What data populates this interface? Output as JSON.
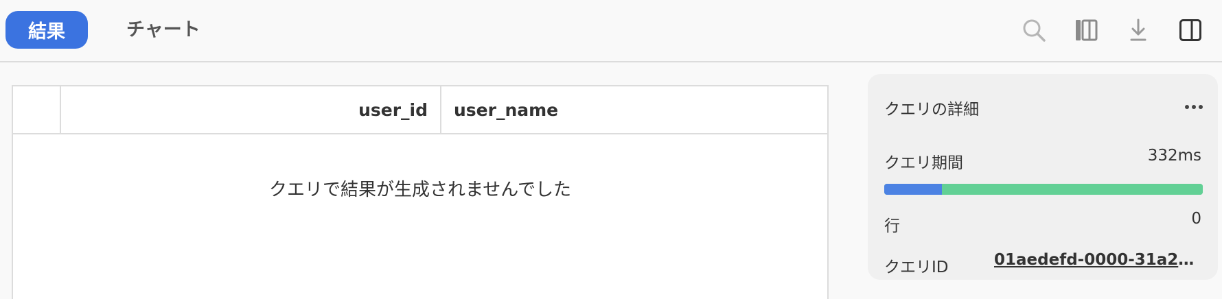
{
  "tabs": {
    "results_label": "結果",
    "chart_label": "チャート"
  },
  "toolbar_icons": [
    "search-icon",
    "columns-icon",
    "download-icon",
    "split-panel-icon"
  ],
  "table": {
    "columns": [
      "",
      "user_id",
      "user_name"
    ],
    "empty_message": "クエリで結果が生成されませんでした"
  },
  "details": {
    "title": "クエリの詳細",
    "duration_label": "クエリ期間",
    "duration_value": "332ms",
    "duration_bar": {
      "segments": [
        {
          "fraction": 0.18,
          "color": "#4c82e3"
        },
        {
          "fraction": 0.82,
          "color": "#62d095"
        }
      ]
    },
    "rows_label": "行",
    "rows_value": "0",
    "query_id_label": "クエリID",
    "query_id_value": "01aedefd-0000-31a2-0..."
  },
  "colors": {
    "accent": "#3b73e0",
    "bar_blue": "#4c82e3",
    "bar_green": "#62d095"
  }
}
